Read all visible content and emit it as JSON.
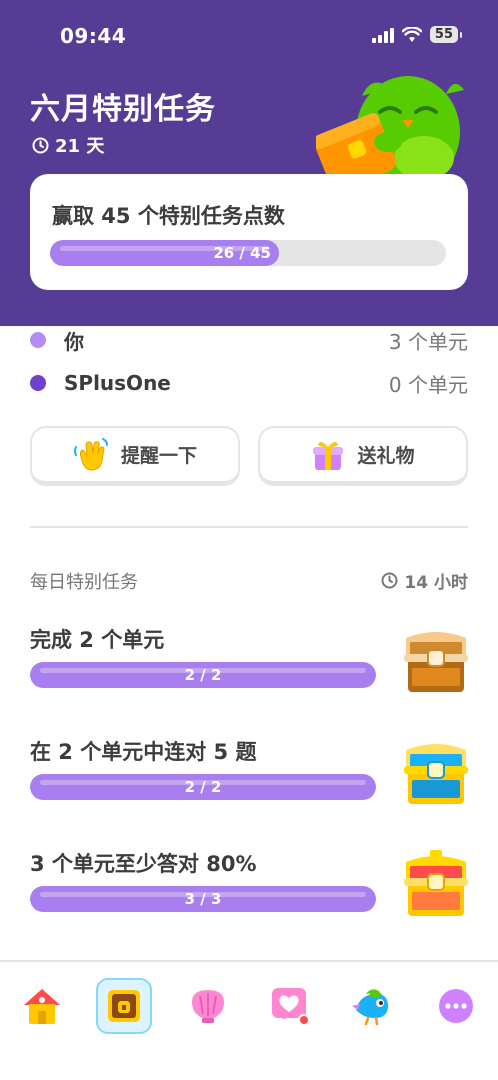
{
  "status": {
    "time": "09:44",
    "battery": "55"
  },
  "quest": {
    "title": "六月特别任务",
    "days": "21 天",
    "goal_text": "赢取 45 个特别任务点数",
    "progress_label": "26 / 45",
    "progress_fraction": 0.578
  },
  "members": [
    {
      "name": "你",
      "units": "3 个单元",
      "color": "#b58cf5"
    },
    {
      "name": "SPlusOne",
      "units": "0 个单元",
      "color": "#6f3fd0"
    }
  ],
  "actions": {
    "nudge_label": "提醒一下",
    "gift_label": "送礼物"
  },
  "daily": {
    "title": "每日特别任务",
    "timer": "14 小时",
    "tasks": [
      {
        "title": "完成 2 个单元",
        "progress_label": "2 / 2",
        "progress_fraction": 1.0,
        "chest": "bronze-chest-icon"
      },
      {
        "title": "在 2 个单元中连对 5 题",
        "progress_label": "2 / 2",
        "progress_fraction": 1.0,
        "chest": "silver-chest-icon"
      },
      {
        "title": "3 个单元至少答对 80%",
        "progress_label": "3 / 3",
        "progress_fraction": 1.0,
        "chest": "gold-chest-icon"
      }
    ]
  },
  "tabs": [
    "home-icon",
    "quests-chest-icon",
    "shell-icon",
    "heart-icon",
    "duo-bird-icon",
    "more-icon"
  ],
  "colors": {
    "header": "#573c96",
    "progress": "#a97ff0",
    "active_tab": "#ddf4ff"
  }
}
